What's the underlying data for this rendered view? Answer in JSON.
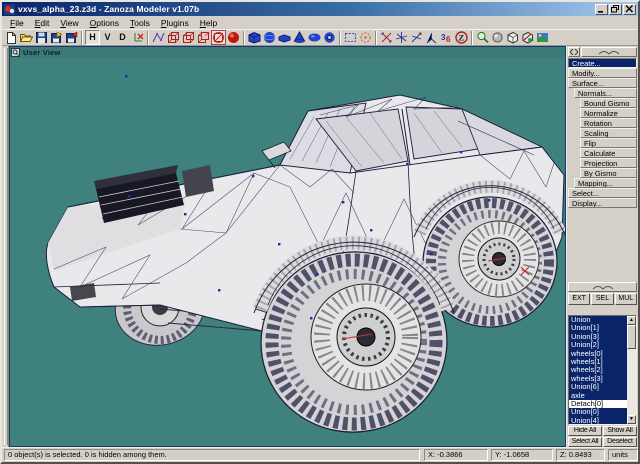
{
  "window": {
    "title": "vxvs_alpha_23.z3d - Zanoza Modeler v1.07b"
  },
  "menu": {
    "items": [
      "File",
      "Edit",
      "View",
      "Options",
      "Tools",
      "Plugins",
      "Help"
    ]
  },
  "toolbar": {
    "view_toggles": [
      "H",
      "V",
      "D"
    ],
    "icons": [
      "new",
      "open",
      "save",
      "import-file",
      "export-file",
      "view-horizontal",
      "view-vertical",
      "view-divided",
      "axes-hide",
      "vertex-mode",
      "wire-cube-1",
      "wire-cube-2",
      "wire-cube-3",
      "wire-cube-disabled",
      "red-sphere",
      "primitive-box",
      "primitive-sphere",
      "primitive-slab",
      "primitive-cone",
      "primitive-ellipsoid",
      "primitive-torus",
      "select-marquee",
      "select-circle",
      "tool-move-star",
      "tool-scale-star",
      "tool-rotate-star",
      "tool-axis-tripod",
      "tool-numeric",
      "zmodeler-disabled",
      "zoom-magnifier",
      "render-sphere",
      "render-cube",
      "texture-box",
      "texture-world"
    ]
  },
  "viewport": {
    "label": "User View"
  },
  "command_panel": {
    "commands": [
      {
        "label": "Create...",
        "indent": 0,
        "selected": true
      },
      {
        "label": "Modify...",
        "indent": 0,
        "selected": false
      },
      {
        "label": "Surface...",
        "indent": 0,
        "selected": false
      },
      {
        "label": "Normals...",
        "indent": 1,
        "selected": false
      },
      {
        "label": "Bound Gismo",
        "indent": 2,
        "selected": false
      },
      {
        "label": "Normalize",
        "indent": 2,
        "selected": false
      },
      {
        "label": "Rotation",
        "indent": 2,
        "selected": false
      },
      {
        "label": "Scaling",
        "indent": 2,
        "selected": false
      },
      {
        "label": "Flip",
        "indent": 2,
        "selected": false
      },
      {
        "label": "Calculate",
        "indent": 2,
        "selected": false
      },
      {
        "label": "Projection",
        "indent": 2,
        "selected": false
      },
      {
        "label": "By Gismo",
        "indent": 2,
        "selected": false
      },
      {
        "label": "Mapping...",
        "indent": 1,
        "selected": false
      },
      {
        "label": "Select...",
        "indent": 0,
        "selected": false
      },
      {
        "label": "Display...",
        "indent": 0,
        "selected": false
      }
    ]
  },
  "mode_buttons": [
    "EXT",
    "SEL",
    "MUL"
  ],
  "object_list": {
    "items": [
      {
        "name": "Union",
        "selected": true
      },
      {
        "name": "Union[1]",
        "selected": true
      },
      {
        "name": "Union[3]",
        "selected": true
      },
      {
        "name": "Union[2]",
        "selected": true
      },
      {
        "name": "wheels[0]",
        "selected": true
      },
      {
        "name": "wheels[1]",
        "selected": true
      },
      {
        "name": "wheels[2]",
        "selected": true
      },
      {
        "name": "wheels[3]",
        "selected": true
      },
      {
        "name": "Union[6]",
        "selected": true
      },
      {
        "name": "axle",
        "selected": true
      },
      {
        "name": "Detach[0]",
        "selected": false
      },
      {
        "name": "Union[0]",
        "selected": true
      },
      {
        "name": "Union[4]",
        "selected": true
      }
    ]
  },
  "list_actions": [
    "Hide All",
    "Show All",
    "Select All",
    "Deselect"
  ],
  "statusbar": {
    "message": "0 object(s) is selected. 0 is hidden among them.",
    "x": "X: -0.3866",
    "y": "Y: -1.0658",
    "z": "Z: 0.8493",
    "units": "units"
  },
  "colors": {
    "viewport_bg": "#3F817D",
    "selection_navy": "#0A246A",
    "titlebar_start": "#0A246A",
    "titlebar_end": "#A6CAF0",
    "chrome": "#D4D0C8",
    "wireframe": "#1C1C3C"
  }
}
